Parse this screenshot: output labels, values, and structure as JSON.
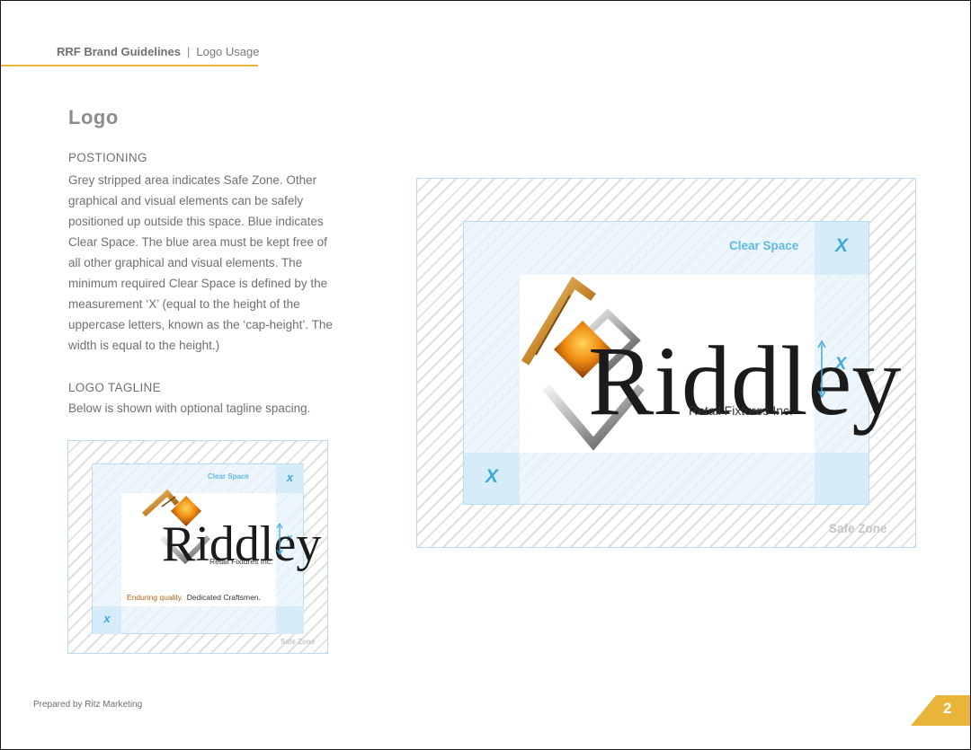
{
  "header": {
    "doc_title": "RRF Brand Guidelines",
    "separator": "|",
    "section": "Logo Usage"
  },
  "title": "Logo",
  "positioning": {
    "heading": "POSTIONING",
    "lines": [
      "Grey stripped area indicates Safe Zone. Other",
      "graphical and visual elements can be safely",
      "positioned up outside this space. Blue indicates",
      "Clear Space. The blue area must be kept free of",
      "all other graphical and visual elements. The",
      "minimum required Clear Space is defined by the",
      "measurement ‘X’ (equal to the height of the",
      "uppercase letters, known as the ‘cap-height’. The",
      "width is equal to the height.)"
    ]
  },
  "tagline_section": {
    "heading": "LOGO TAGLINE",
    "text": "Below is shown with optional tagline spacing."
  },
  "diagram": {
    "clear_space_label": "Clear Space",
    "safe_zone_label": "Safe Zone",
    "x_label": "X",
    "x_label_small": "x"
  },
  "logo": {
    "wordmark": "Riddley",
    "subtitle": "Retail Fixtures Inc.",
    "tagline_part1": "Enduring quality.",
    "tagline_part2": "Dedicated Craftsmen."
  },
  "footer": {
    "prepared_by": "Prepared by Ritz Marketing"
  },
  "page_number": "2",
  "colors": {
    "accent": "#e8b53a",
    "clear_space_blue": "#3fa9dc",
    "text_grey": "#707070"
  }
}
